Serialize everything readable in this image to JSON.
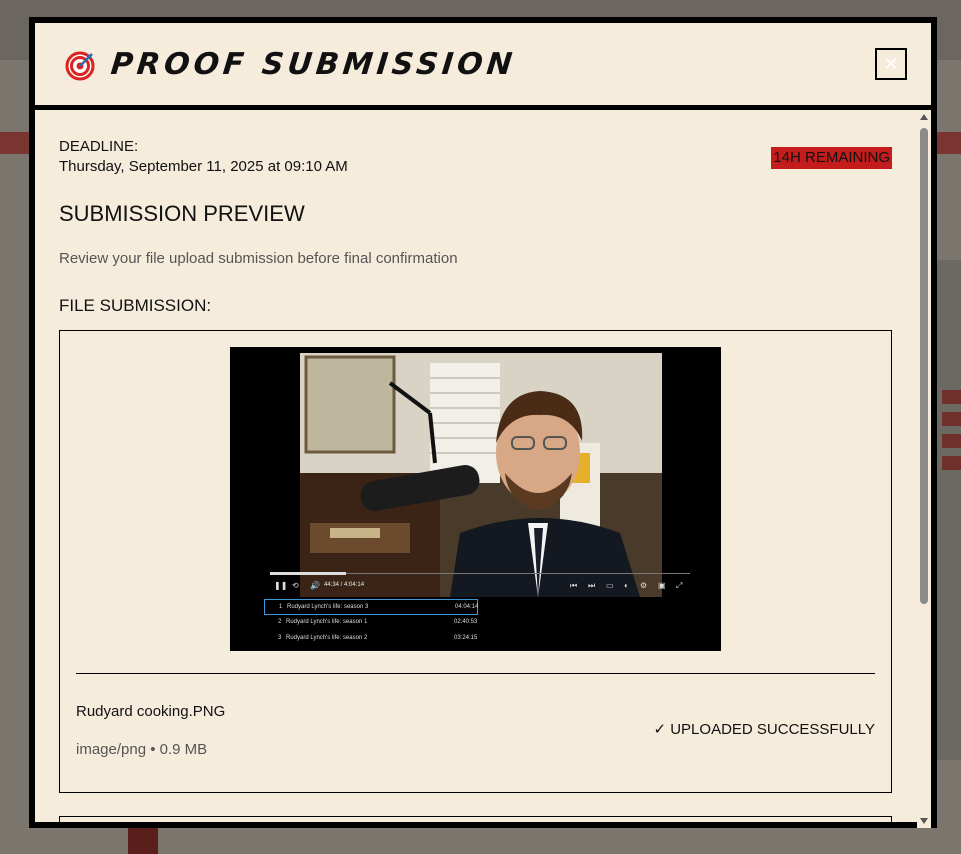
{
  "modal": {
    "title": "PROOF SUBMISSION",
    "icon": "target-icon",
    "close_label": "✕"
  },
  "deadline": {
    "label": "DEADLINE:",
    "value": "Thursday, September 11, 2025 at 09:10 AM",
    "remaining": "14H REMAINING"
  },
  "preview": {
    "title": "SUBMISSION PREVIEW",
    "subtitle": "Review your file upload submission before final confirmation"
  },
  "file_section": {
    "heading": "FILE SUBMISSION:"
  },
  "file": {
    "name": "Rudyard cooking.PNG",
    "meta": "image/png • 0.9 MB",
    "status": "✓ UPLOADED SUCCESSFULLY",
    "screenshot": {
      "time": "44:34 / 4:04:14",
      "playlist": [
        {
          "num": "1",
          "name": "Rudyard Lynch's life: season 3",
          "duration": "04:04:14"
        },
        {
          "num": "2",
          "name": "Rudyard Lynch's life: season 1",
          "duration": "02:40:53"
        },
        {
          "num": "3",
          "name": "Rudyard Lynch's life: season 2",
          "duration": "03:24:15"
        }
      ]
    }
  },
  "colors": {
    "panel_bg": "#f5ecdc",
    "badge_red": "#c41c1c",
    "border": "#000000"
  }
}
